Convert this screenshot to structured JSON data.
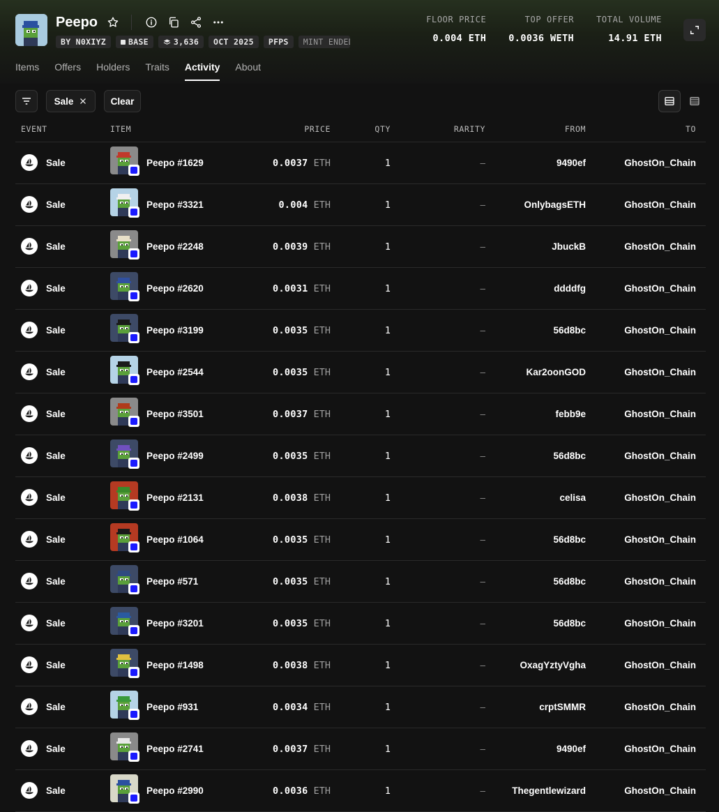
{
  "collection": {
    "title": "Peepo",
    "chips": [
      "BY N0XIYZ",
      "BASE",
      "3,636",
      "OCT 2025",
      "PFPS",
      "MINT ENDED"
    ]
  },
  "stats": [
    {
      "label": "FLOOR PRICE",
      "value": "0.004 ETH"
    },
    {
      "label": "TOP OFFER",
      "value": "0.0036 WETH"
    },
    {
      "label": "TOTAL VOLUME",
      "value": "14.91 ETH"
    }
  ],
  "tabs": [
    "Items",
    "Offers",
    "Holders",
    "Traits",
    "Activity",
    "About"
  ],
  "active_tab": "Activity",
  "filters": {
    "sale_chip": "Sale",
    "clear_label": "Clear"
  },
  "columns": {
    "event": "EVENT",
    "item": "ITEM",
    "price": "PRICE",
    "qty": "QTY",
    "rarity": "RARITY",
    "from": "FROM",
    "to": "TO"
  },
  "rows": [
    {
      "event": "Sale",
      "item": "Peepo #1629",
      "price": "0.0037",
      "currency": "ETH",
      "qty": "1",
      "rarity": "–",
      "from": "9490ef",
      "to": "GhostOn_Chain",
      "bg": "#8a8a8a",
      "hat": "#c0392b"
    },
    {
      "event": "Sale",
      "item": "Peepo #3321",
      "price": "0.004",
      "currency": "ETH",
      "qty": "1",
      "rarity": "–",
      "from": "OnlybagsETH",
      "to": "GhostOn_Chain",
      "bg": "#b5d3e6",
      "hat": "#f0f0f0"
    },
    {
      "event": "Sale",
      "item": "Peepo #2248",
      "price": "0.0039",
      "currency": "ETH",
      "qty": "1",
      "rarity": "–",
      "from": "JbuckB",
      "to": "GhostOn_Chain",
      "bg": "#8a8a8a",
      "hat": "#e8e0c8"
    },
    {
      "event": "Sale",
      "item": "Peepo #2620",
      "price": "0.0031",
      "currency": "ETH",
      "qty": "1",
      "rarity": "–",
      "from": "ddddfg",
      "to": "GhostOn_Chain",
      "bg": "#3d4a66",
      "hat": "#3050a0"
    },
    {
      "event": "Sale",
      "item": "Peepo #3199",
      "price": "0.0035",
      "currency": "ETH",
      "qty": "1",
      "rarity": "–",
      "from": "56d8bc",
      "to": "GhostOn_Chain",
      "bg": "#3d4a66",
      "hat": "#1a1a1a"
    },
    {
      "event": "Sale",
      "item": "Peepo #2544",
      "price": "0.0035",
      "currency": "ETH",
      "qty": "1",
      "rarity": "–",
      "from": "Kar2oonGOD",
      "to": "GhostOn_Chain",
      "bg": "#b5d3e6",
      "hat": "#1a1a1a"
    },
    {
      "event": "Sale",
      "item": "Peepo #3501",
      "price": "0.0037",
      "currency": "ETH",
      "qty": "1",
      "rarity": "–",
      "from": "febb9e",
      "to": "GhostOn_Chain",
      "bg": "#8a8a8a",
      "hat": "#b03a1a"
    },
    {
      "event": "Sale",
      "item": "Peepo #2499",
      "price": "0.0035",
      "currency": "ETH",
      "qty": "1",
      "rarity": "–",
      "from": "56d8bc",
      "to": "GhostOn_Chain",
      "bg": "#3d4a66",
      "hat": "#7050c0"
    },
    {
      "event": "Sale",
      "item": "Peepo #2131",
      "price": "0.0038",
      "currency": "ETH",
      "qty": "1",
      "rarity": "–",
      "from": "celisa",
      "to": "GhostOn_Chain",
      "bg": "#b53a22",
      "hat": "#3a8a2a"
    },
    {
      "event": "Sale",
      "item": "Peepo #1064",
      "price": "0.0035",
      "currency": "ETH",
      "qty": "1",
      "rarity": "–",
      "from": "56d8bc",
      "to": "GhostOn_Chain",
      "bg": "#b53a22",
      "hat": "#1a1a1a"
    },
    {
      "event": "Sale",
      "item": "Peepo #571",
      "price": "0.0035",
      "currency": "ETH",
      "qty": "1",
      "rarity": "–",
      "from": "56d8bc",
      "to": "GhostOn_Chain",
      "bg": "#3d4a66",
      "hat": "#2f4a80"
    },
    {
      "event": "Sale",
      "item": "Peepo #3201",
      "price": "0.0035",
      "currency": "ETH",
      "qty": "1",
      "rarity": "–",
      "from": "56d8bc",
      "to": "GhostOn_Chain",
      "bg": "#3d4a66",
      "hat": "#2a5aa0"
    },
    {
      "event": "Sale",
      "item": "Peepo #1498",
      "price": "0.0038",
      "currency": "ETH",
      "qty": "1",
      "rarity": "–",
      "from": "OxagYztyVgha",
      "to": "GhostOn_Chain",
      "bg": "#3d4a66",
      "hat": "#e0c040"
    },
    {
      "event": "Sale",
      "item": "Peepo #931",
      "price": "0.0034",
      "currency": "ETH",
      "qty": "1",
      "rarity": "–",
      "from": "crptSMMR",
      "to": "GhostOn_Chain",
      "bg": "#b5d3e6",
      "hat": "#3a9a3a"
    },
    {
      "event": "Sale",
      "item": "Peepo #2741",
      "price": "0.0037",
      "currency": "ETH",
      "qty": "1",
      "rarity": "–",
      "from": "9490ef",
      "to": "GhostOn_Chain",
      "bg": "#8a8a8a",
      "hat": "#e8e8e8"
    },
    {
      "event": "Sale",
      "item": "Peepo #2990",
      "price": "0.0036",
      "currency": "ETH",
      "qty": "1",
      "rarity": "–",
      "from": "Thegentlewizard",
      "to": "GhostOn_Chain",
      "bg": "#d8d8c8",
      "hat": "#2a50a0"
    }
  ],
  "icons": {
    "star": "star-icon",
    "info": "info-icon",
    "copy": "copy-icon",
    "share": "share-icon",
    "more": "more-icon",
    "expand": "expand-icon",
    "filter": "filter-icon",
    "close": "close-icon",
    "sale_event": "opensea-sail-icon",
    "chain": "base-chain-icon"
  }
}
